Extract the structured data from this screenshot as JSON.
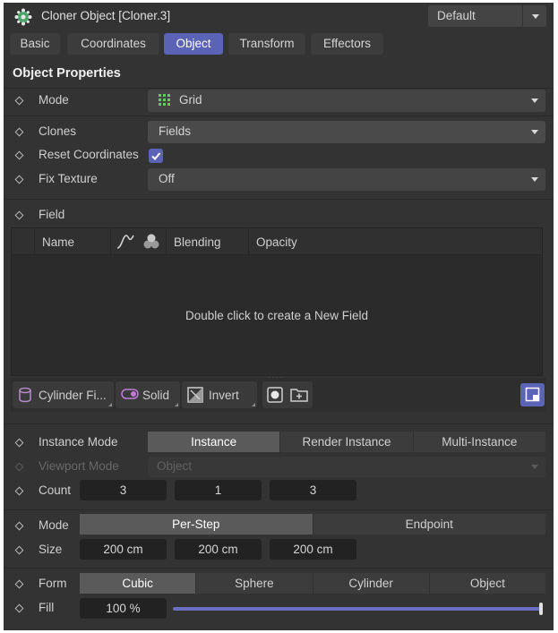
{
  "header": {
    "title": "Cloner Object [Cloner.3]",
    "preset": "Default",
    "icon": "cloner-icon"
  },
  "tabs": [
    {
      "label": "Basic",
      "active": false
    },
    {
      "label": "Coordinates",
      "active": false
    },
    {
      "label": "Object",
      "active": true
    },
    {
      "label": "Transform",
      "active": false
    },
    {
      "label": "Effectors",
      "active": false
    }
  ],
  "section_title": "Object Properties",
  "mode": {
    "label": "Mode",
    "value": "Grid",
    "icon": "grid-icon"
  },
  "clones": {
    "label": "Clones",
    "value": "Fields"
  },
  "reset_coordinates": {
    "label": "Reset Coordinates",
    "checked": true
  },
  "fix_texture": {
    "label": "Fix Texture",
    "value": "Off"
  },
  "field": {
    "label": "Field",
    "columns": {
      "name": "Name",
      "blending": "Blending",
      "opacity": "Opacity"
    },
    "empty_text": "Double click to create a New Field",
    "handle": "....",
    "toolbar": {
      "cylinder": "Cylinder Fi...",
      "solid": "Solid",
      "invert": "Invert"
    }
  },
  "instance_mode": {
    "label": "Instance Mode",
    "options": [
      "Instance",
      "Render Instance",
      "Multi-Instance"
    ],
    "selected": "Instance"
  },
  "viewport_mode": {
    "label": "Viewport Mode",
    "value": "Object",
    "enabled": false
  },
  "count": {
    "label": "Count",
    "values": [
      "3",
      "1",
      "3"
    ]
  },
  "mode2": {
    "label": "Mode",
    "options": [
      "Per-Step",
      "Endpoint"
    ],
    "selected": "Per-Step"
  },
  "size": {
    "label": "Size",
    "values": [
      "200 cm",
      "200 cm",
      "200 cm"
    ]
  },
  "form": {
    "label": "Form",
    "options": [
      "Cubic",
      "Sphere",
      "Cylinder",
      "Object"
    ],
    "selected": "Cubic"
  },
  "fill": {
    "label": "Fill",
    "value": "100 %",
    "fraction": 1.0
  },
  "colors": {
    "background": "#333333",
    "accent": "#5b63b6",
    "checkbox": "#5b63b6",
    "slider": "#6a6fc0"
  }
}
